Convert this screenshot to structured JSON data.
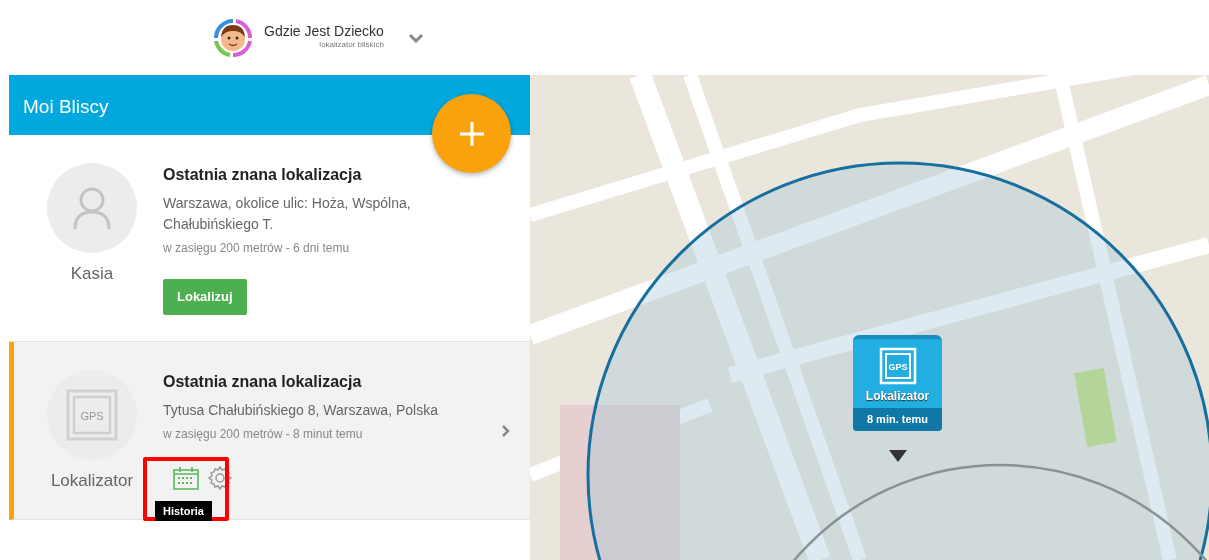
{
  "header": {
    "app_name": "Gdzie Jest Dziecko",
    "tagline": "lokalizator bliskich"
  },
  "panel": {
    "title": "Moi Bliscy"
  },
  "people": [
    {
      "name": "Kasia",
      "kind": "person",
      "selected": false,
      "heading": "Ostatnia znana lokalizacja",
      "address": "Warszawa, okolice ulic: Hoża, Wspólna, Chałubińskiego T.",
      "accuracy": "w zasięgu 200 metrów - 6 dni temu",
      "action": "Lokalizuj"
    },
    {
      "name": "Lokalizator",
      "kind": "gps",
      "avatar_label": "GPS",
      "selected": true,
      "heading": "Ostatnia znana lokalizacja",
      "address": "Tytusa Chałubińskiego 8, Warszawa, Polska",
      "accuracy": "w zasięgu 200 metrów - 8 minut temu",
      "tooltip": "Historia"
    }
  ],
  "map": {
    "marker": {
      "icon_label": "GPS",
      "title": "Lokalizator",
      "time": "8 min. temu"
    }
  }
}
